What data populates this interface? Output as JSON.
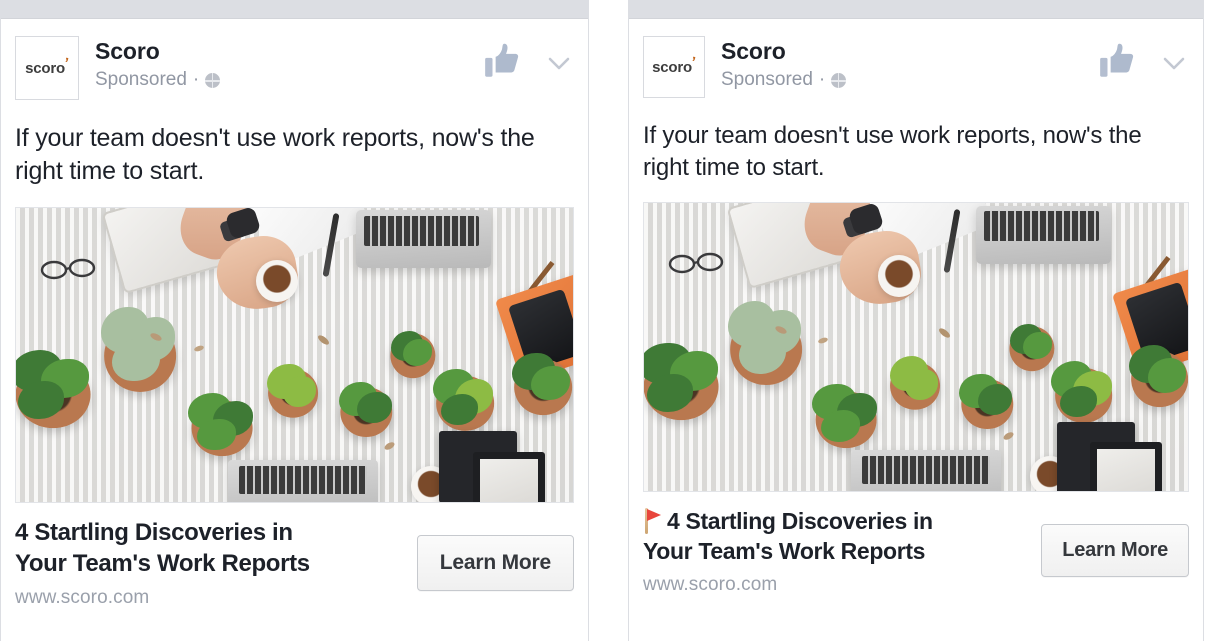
{
  "page": {
    "background": "#ffffff",
    "card_border_color": "#dcdee3",
    "topbar_color": "#dcdee3"
  },
  "cards": [
    {
      "id": "ad-card-without-emoji",
      "brand": {
        "logo_text": "scoro",
        "logo_accent": "’",
        "logo_accent_color": "#c4681f",
        "name": "Scoro",
        "sponsored_label": "Sponsored",
        "separator": "·",
        "audience_icon": "globe-icon"
      },
      "actions": {
        "like_icon": "thumbs-up-icon",
        "menu_icon": "chevron-down-icon"
      },
      "copy": "If your team doesn't use work reports, now's the right time to start.",
      "photo": {
        "alt": "Overhead flat-lay of a white desk with hands writing on a tablet, eyeglasses, a laptop, a coffee cup, an orange notebook, a smartphone, picture frames and many potted green plants.",
        "accent_colors": [
          "#e7e6e3",
          "#56993f",
          "#8dbb44",
          "#b9784f",
          "#dd6f34",
          "#25262a"
        ]
      },
      "link": {
        "has_flag_emoji": false,
        "flag_emoji": "",
        "title_line1": "4 Startling Discoveries in",
        "title_line2": "Your Team's Work Reports",
        "url": "www.scoro.com",
        "cta_label": "Learn More"
      }
    },
    {
      "id": "ad-card-with-emoji",
      "brand": {
        "logo_text": "scoro",
        "logo_accent": "’",
        "logo_accent_color": "#c4681f",
        "name": "Scoro",
        "sponsored_label": "Sponsored",
        "separator": "·",
        "audience_icon": "globe-icon"
      },
      "actions": {
        "like_icon": "thumbs-up-icon",
        "menu_icon": "chevron-down-icon"
      },
      "copy": "If your team doesn't use work reports, now's the right time to start.",
      "photo": {
        "alt": "Overhead flat-lay of a white desk with hands writing on a tablet, eyeglasses, a laptop, a coffee cup, an orange notebook, a smartphone, picture frames and many potted green plants.",
        "accent_colors": [
          "#e7e6e3",
          "#56993f",
          "#8dbb44",
          "#b9784f",
          "#dd6f34",
          "#25262a"
        ]
      },
      "link": {
        "has_flag_emoji": true,
        "flag_emoji": "🚩",
        "flag_color": "#e8463c",
        "title_line1": "4 Startling Discoveries in",
        "title_line2": "Your Team's Work Reports",
        "url": "www.scoro.com",
        "cta_label": "Learn More"
      }
    }
  ]
}
